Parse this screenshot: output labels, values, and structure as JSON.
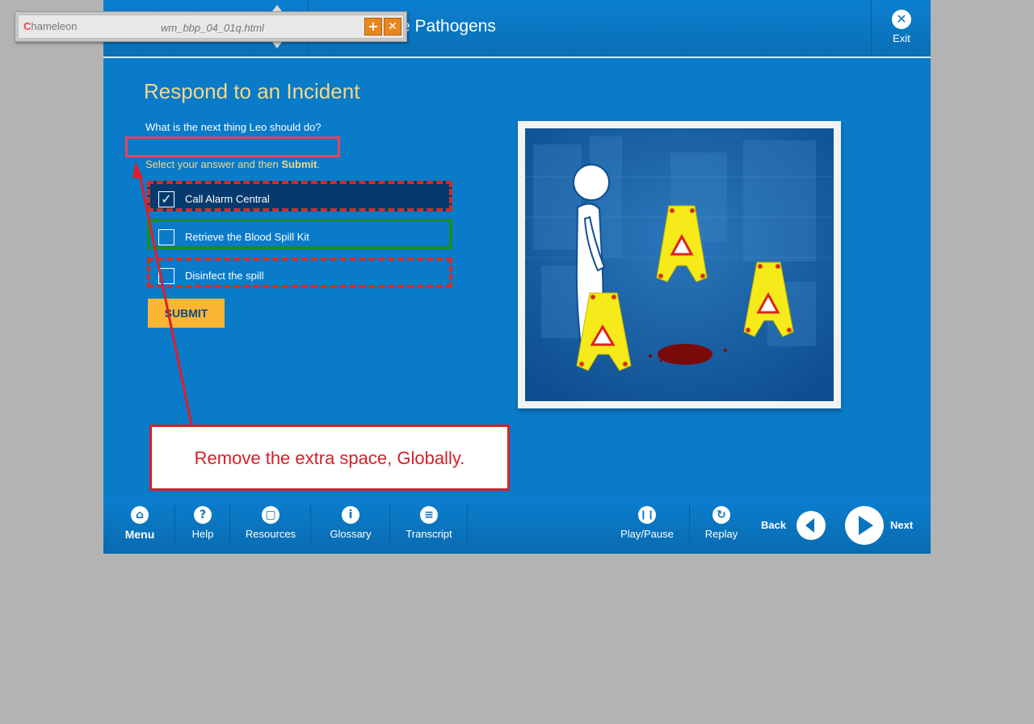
{
  "header": {
    "course_title": "e Pathogens",
    "exit_label": "Exit",
    "exit_icon": "close-circle-icon"
  },
  "popup": {
    "logo_initial": "C",
    "logo_text": "hameleon",
    "filename": "wm_bbp_04_01q.html",
    "add_icon": "plus-icon",
    "close_icon": "close-icon"
  },
  "content": {
    "title": "Respond to an Incident",
    "question": "What is the next thing Leo should do?",
    "instruction_prefix": "Select your answer and then ",
    "instruction_bold": "Submit",
    "instruction_suffix": ".",
    "options": [
      {
        "label": "Call Alarm Central",
        "checked": true
      },
      {
        "label": "Retrieve the Blood Spill Kit",
        "checked": false
      },
      {
        "label": "Disinfect the spill",
        "checked": false
      }
    ],
    "submit_label": "SUBMIT"
  },
  "annotation": {
    "text": "Remove the extra space, Globally."
  },
  "footer": {
    "menu_label": "Menu",
    "help_label": "Help",
    "resources_label": "Resources",
    "glossary_label": "Glossary",
    "transcript_label": "Transcript",
    "playpause_label": "Play/Pause",
    "replay_label": "Replay",
    "back_label": "Back",
    "next_label": "Next"
  },
  "colors": {
    "background": "#b3b3b3",
    "app_blue": "#0a7bc8",
    "title_gold": "#f3d78a",
    "submit_yellow": "#fbb633",
    "annotation_red": "#d4202a",
    "correct_green": "#1a8a2c"
  }
}
